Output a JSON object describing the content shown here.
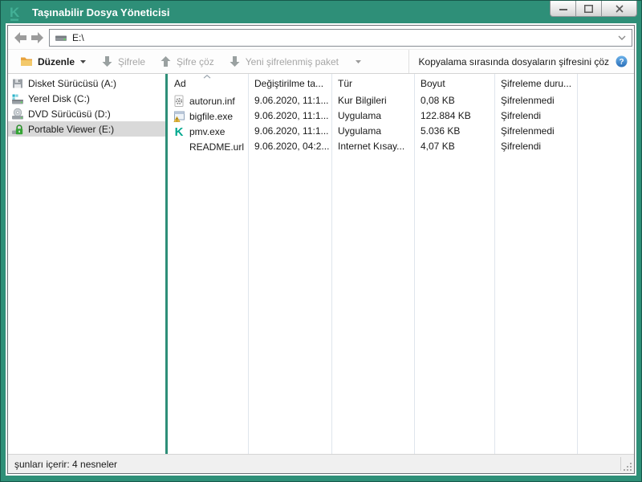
{
  "window": {
    "title": "Taşınabilir Dosya Yöneticisi",
    "controls": {
      "minimize": "minimize",
      "maximize": "maximize",
      "close": "close"
    }
  },
  "navbar": {
    "address": "E:\\"
  },
  "toolbar": {
    "edit_label": "Düzenle",
    "encrypt_label": "Şifrele",
    "decrypt_label": "Şifre çöz",
    "new_package_label": "Yeni şifrelenmiş paket",
    "copy_decrypt_label": "Kopyalama sırasında dosyaların şifresini çöz"
  },
  "sidebar": {
    "items": [
      {
        "label": "Disket Sürücüsü (A:)",
        "icon": "floppy-drive-icon",
        "selected": false
      },
      {
        "label": "Yerel Disk (C:)",
        "icon": "hard-drive-icon",
        "selected": false
      },
      {
        "label": "DVD Sürücüsü (D:)",
        "icon": "dvd-drive-icon",
        "selected": false
      },
      {
        "label": "Portable Viewer (E:)",
        "icon": "locked-drive-icon",
        "selected": true
      }
    ]
  },
  "filelist": {
    "columns": {
      "name": "Ad",
      "modified": "Değiştirilme ta...",
      "type": "Tür",
      "size": "Boyut",
      "encryption": "Şifreleme duru..."
    },
    "sort": {
      "column": "Ad",
      "direction": "ascending"
    },
    "rows": [
      {
        "name": "autorun.inf",
        "icon": "setup-information-file-icon",
        "modified": "9.06.2020, 11:1...",
        "type": "Kur Bilgileri",
        "size": "0,08 KB",
        "encryption": "Şifrelenmedi"
      },
      {
        "name": "bigfile.exe",
        "icon": "application-file-icon",
        "modified": "9.06.2020, 11:1...",
        "type": "Uygulama",
        "size": "122.884 KB",
        "encryption": "Şifrelendi"
      },
      {
        "name": "pmv.exe",
        "icon": "kaspersky-application-icon",
        "modified": "9.06.2020, 11:1...",
        "type": "Uygulama",
        "size": "5.036 KB",
        "encryption": "Şifrelenmedi"
      },
      {
        "name": "README.url",
        "icon": "none",
        "modified": "9.06.2020, 04:2...",
        "type": "Internet Kısay...",
        "size": "4,07 KB",
        "encryption": "Şifrelendi"
      }
    ]
  },
  "statusbar": {
    "text": "şunları içerir: 4 nesneler"
  },
  "colors": {
    "titlebar": "#2E8F78",
    "logo": "#43B096",
    "splitter": "#2E8F78",
    "selected_bg": "#D9D9D9",
    "disabled_text": "#A6A6A6",
    "help_icon": "#3E8ED6",
    "folder_icon": "#E8A33D",
    "kaspersky_teal": "#00A88E"
  }
}
